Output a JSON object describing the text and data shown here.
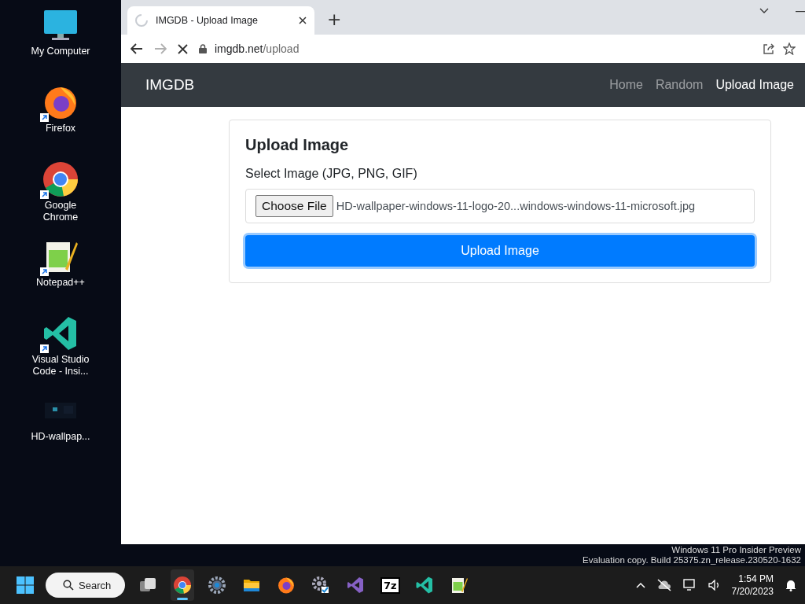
{
  "desktop": {
    "icons": [
      {
        "kind": "computer",
        "label": "My Computer",
        "shortcut": false
      },
      {
        "kind": "firefox",
        "label": "Firefox",
        "shortcut": true
      },
      {
        "kind": "chrome",
        "label": "Google Chrome",
        "shortcut": true
      },
      {
        "kind": "notepad",
        "label": "Notepad++",
        "shortcut": true
      },
      {
        "kind": "vscode",
        "label": "Visual Studio Code - Insi...",
        "shortcut": true
      },
      {
        "label": "HD-wallpap...",
        "shortcut": false
      }
    ],
    "watermark": [
      "Windows 11 Pro Insider Preview",
      "Evaluation copy. Build 25375.zn_release.230520-1632"
    ]
  },
  "browser": {
    "tab": {
      "title": "IMGDB - Upload Image",
      "loading": true
    },
    "new_tab": "+",
    "address": {
      "host": "imgdb.net",
      "path": "/upload"
    },
    "forward_disabled": true
  },
  "page": {
    "brand": "IMGDB",
    "nav": [
      {
        "label": "Home",
        "selected": false
      },
      {
        "label": "Random",
        "selected": false
      },
      {
        "label": "Upload Image",
        "selected": true
      }
    ],
    "card": {
      "title": "Upload Image",
      "label": "Select Image (JPG, PNG, GIF)",
      "file_button": "Choose File",
      "file_name": "HD-wallpaper-windows-11-logo-20...windows-windows-11-microsoft.jpg",
      "submit": "Upload Image"
    }
  },
  "taskbar": {
    "search": "Search",
    "apps": [
      {
        "kind": "taskview",
        "active": false
      },
      {
        "kind": "chrome",
        "active": true
      },
      {
        "kind": "settings",
        "active": false
      },
      {
        "kind": "folder",
        "active": false
      },
      {
        "kind": "firefox",
        "active": false
      },
      {
        "kind": "gearcheck",
        "active": false
      },
      {
        "kind": "vs",
        "active": false
      },
      {
        "kind": "sevenzip",
        "active": false,
        "label": "7z"
      },
      {
        "kind": "vscode",
        "active": false
      },
      {
        "kind": "notepad",
        "active": false
      }
    ],
    "time": "1:54 PM",
    "date": "7/20/2023"
  }
}
